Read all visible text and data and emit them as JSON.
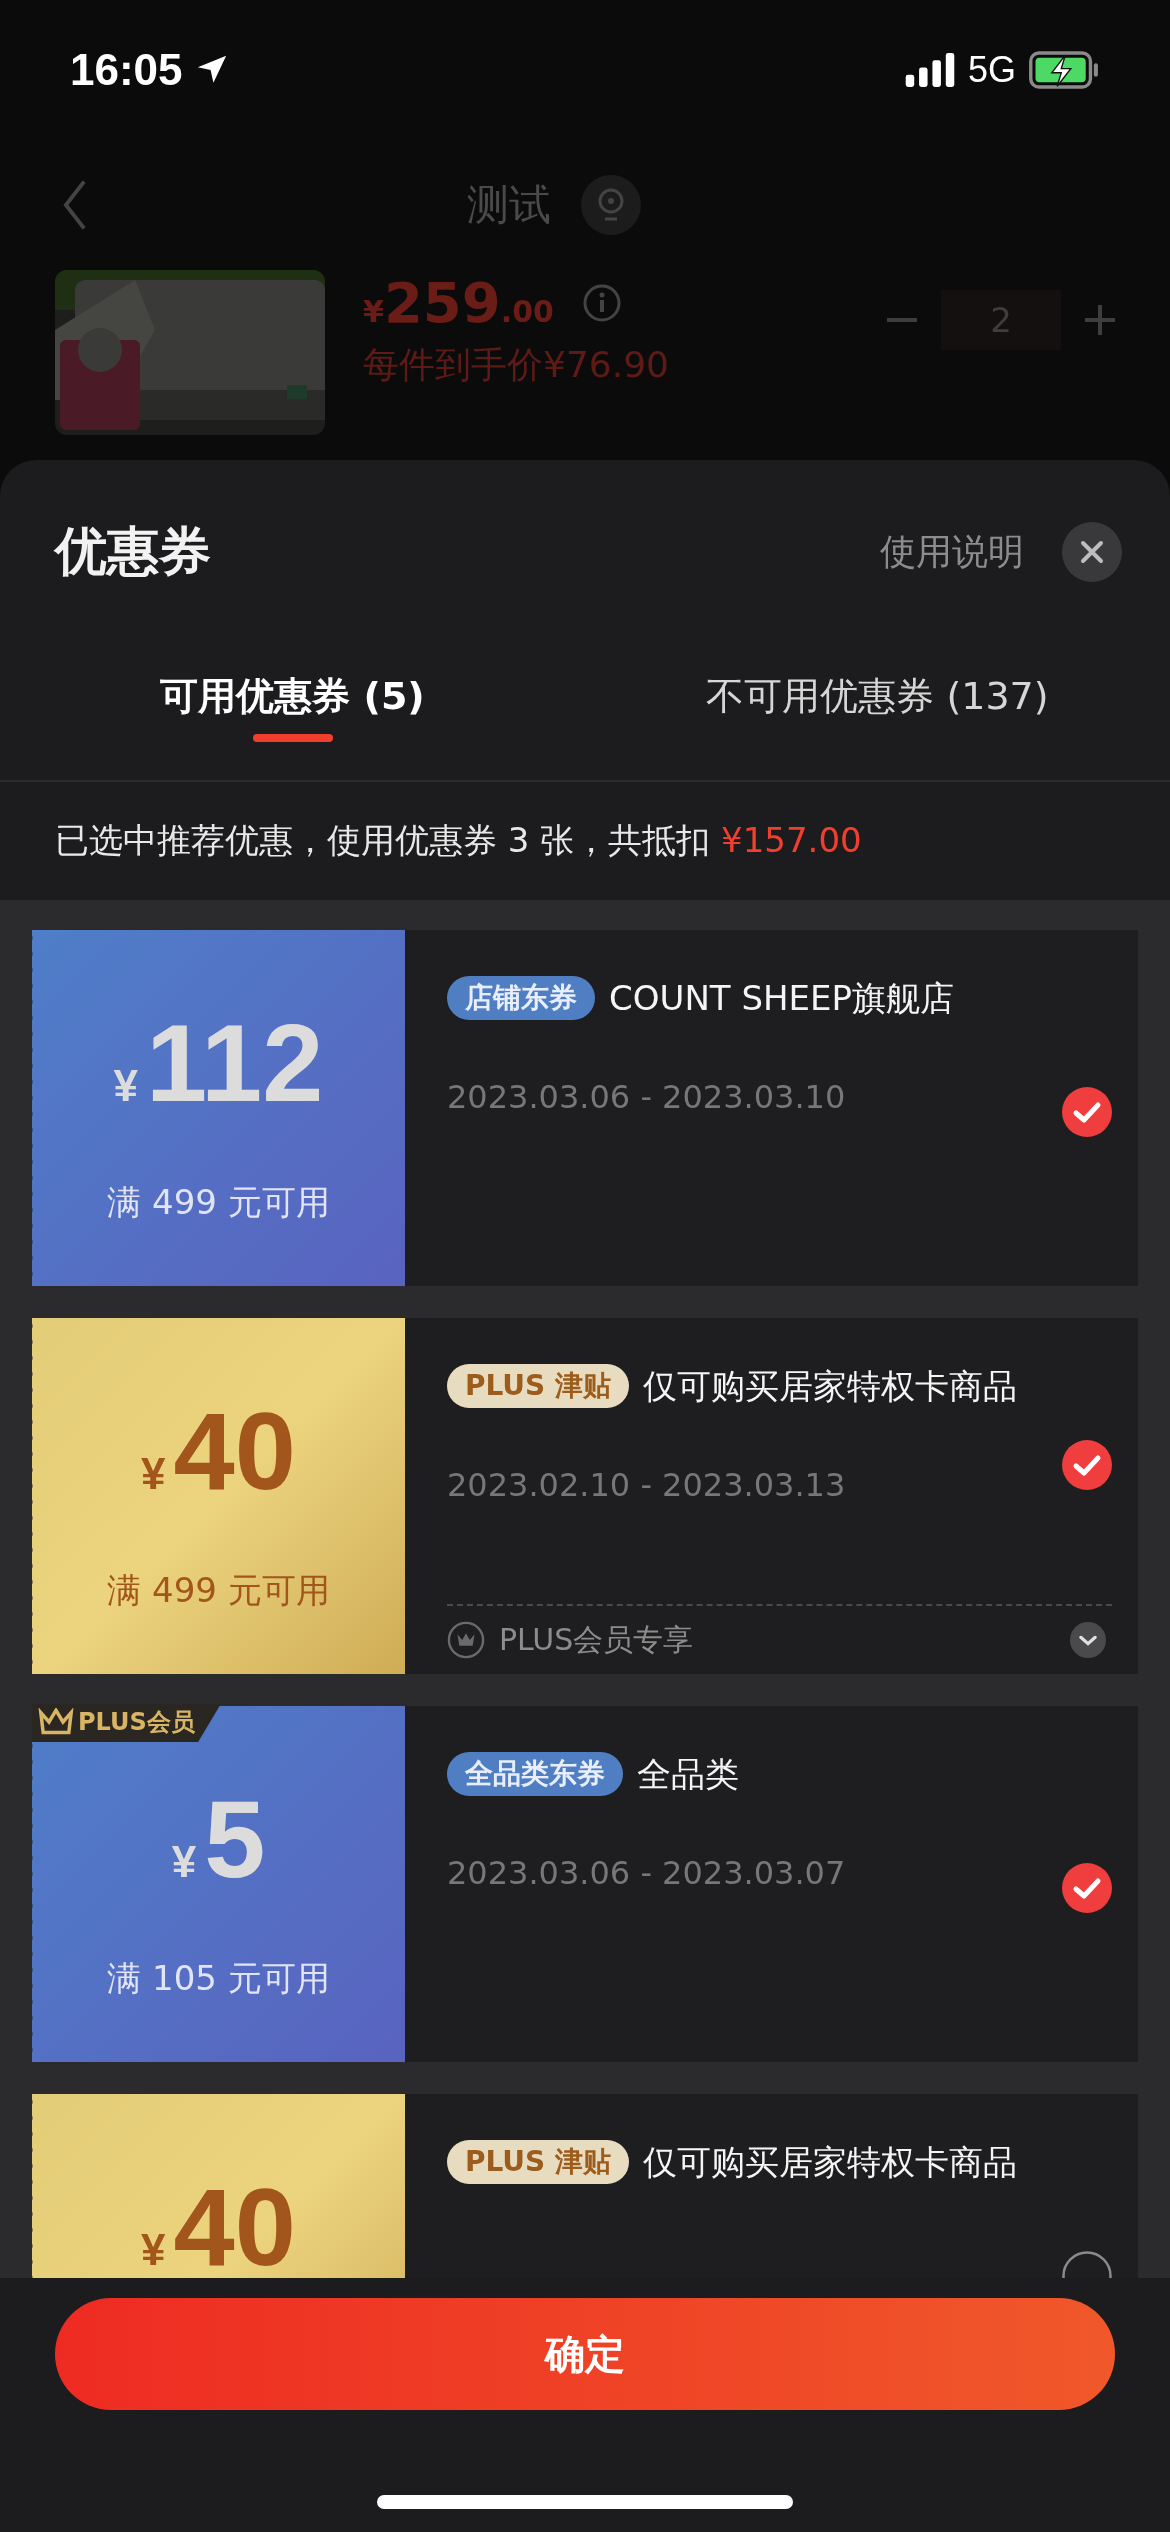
{
  "status_bar": {
    "time": "16:05",
    "network": "5G"
  },
  "page_header": {
    "title": "测试"
  },
  "product": {
    "currency": "¥",
    "price": "259",
    "cents": ".00",
    "unit_price": "每件到手价¥76.90",
    "quantity": "2"
  },
  "sheet": {
    "title": "优惠券",
    "help_link": "使用说明"
  },
  "tabs": [
    {
      "label": "可用优惠券 (5)",
      "selected": true
    },
    {
      "label": "不可用优惠券 (137)",
      "selected": false
    }
  ],
  "summary": {
    "text": "已选中推荐优惠，使用优惠券 3 张，共抵扣 ",
    "amount": "¥157.00"
  },
  "coupons": [
    {
      "kind": "blue",
      "currency": "¥",
      "amount": "112",
      "condition": "满 499 元可用",
      "tag": "店铺东券",
      "title": "COUNT SHEEP旗舰店",
      "dates": "2023.03.06 - 2023.03.10",
      "checked": true
    },
    {
      "kind": "gold",
      "currency": "¥",
      "amount": "40",
      "condition": "满 499 元可用",
      "tag": "PLUS 津贴",
      "title": "仅可购买居家特权卡商品",
      "dates": "2023.02.10 - 2023.03.13",
      "checked": true,
      "footer": "PLUS会员专享"
    },
    {
      "kind": "blue",
      "corner_badge": "PLUS会员",
      "currency": "¥",
      "amount": "5",
      "condition": "满 105 元可用",
      "tag": "全品类东券",
      "title": "全品类",
      "dates": "2023.03.06 - 2023.03.07",
      "checked": true
    },
    {
      "kind": "gold",
      "currency": "¥",
      "amount": "40",
      "tag": "PLUS 津贴",
      "title": "仅可购买居家特权卡商品",
      "checked": false
    }
  ],
  "confirm_button": "确定"
}
